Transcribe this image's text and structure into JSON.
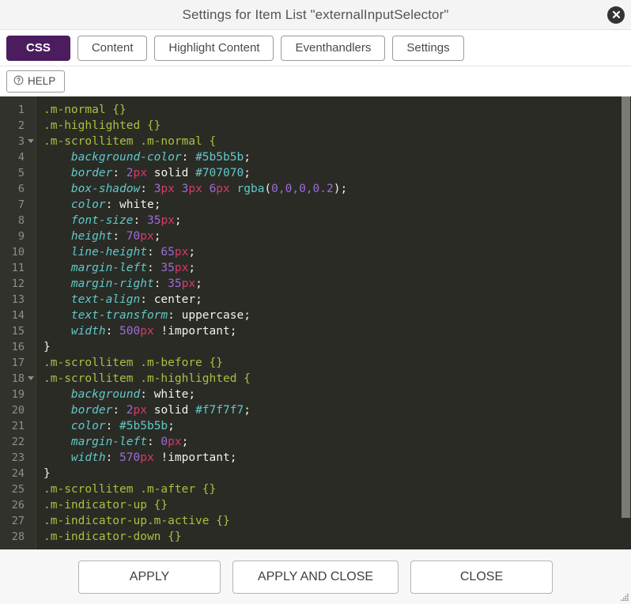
{
  "window": {
    "title": "Settings for Item List \"externalInputSelector\"",
    "close_icon": "close-circle-icon"
  },
  "tabs": [
    {
      "label": "CSS",
      "active": true
    },
    {
      "label": "Content",
      "active": false
    },
    {
      "label": "Highlight Content",
      "active": false
    },
    {
      "label": "Eventhandlers",
      "active": false
    },
    {
      "label": "Settings",
      "active": false
    }
  ],
  "toolbar": {
    "help_label": "HELP",
    "help_icon": "question-circle-icon"
  },
  "editor": {
    "language": "css",
    "first_visible_line": 1,
    "last_visible_line": 28,
    "lines": [
      {
        "n": 1,
        "fold": false,
        "tokens": [
          {
            "t": "sel",
            "v": ".m-normal {}"
          }
        ]
      },
      {
        "n": 2,
        "fold": false,
        "tokens": [
          {
            "t": "sel",
            "v": ".m-highlighted {}"
          }
        ]
      },
      {
        "n": 3,
        "fold": true,
        "tokens": [
          {
            "t": "sel",
            "v": ".m-scrollitem .m-normal {"
          }
        ]
      },
      {
        "n": 4,
        "fold": false,
        "tokens": [
          {
            "t": "prop",
            "v": "    background-color"
          },
          {
            "t": "punc",
            "v": ": "
          },
          {
            "t": "hex",
            "v": "#5b5b5b"
          },
          {
            "t": "punc",
            "v": ";"
          }
        ]
      },
      {
        "n": 5,
        "fold": false,
        "tokens": [
          {
            "t": "prop",
            "v": "    border"
          },
          {
            "t": "punc",
            "v": ": "
          },
          {
            "t": "num",
            "v": "2"
          },
          {
            "t": "unit",
            "v": "px"
          },
          {
            "t": "val",
            "v": " solid "
          },
          {
            "t": "hex",
            "v": "#707070"
          },
          {
            "t": "punc",
            "v": ";"
          }
        ]
      },
      {
        "n": 6,
        "fold": false,
        "tokens": [
          {
            "t": "prop",
            "v": "    box-shadow"
          },
          {
            "t": "punc",
            "v": ": "
          },
          {
            "t": "num",
            "v": "3"
          },
          {
            "t": "unit",
            "v": "px"
          },
          {
            "t": "val",
            "v": " "
          },
          {
            "t": "num",
            "v": "3"
          },
          {
            "t": "unit",
            "v": "px"
          },
          {
            "t": "val",
            "v": " "
          },
          {
            "t": "num",
            "v": "6"
          },
          {
            "t": "unit",
            "v": "px"
          },
          {
            "t": "val",
            "v": " "
          },
          {
            "t": "func",
            "v": "rgba"
          },
          {
            "t": "punc",
            "v": "("
          },
          {
            "t": "num",
            "v": "0,0,0,0.2"
          },
          {
            "t": "punc",
            "v": ");"
          }
        ]
      },
      {
        "n": 7,
        "fold": false,
        "tokens": [
          {
            "t": "prop",
            "v": "    color"
          },
          {
            "t": "punc",
            "v": ": "
          },
          {
            "t": "val",
            "v": "white"
          },
          {
            "t": "punc",
            "v": ";"
          }
        ]
      },
      {
        "n": 8,
        "fold": false,
        "tokens": [
          {
            "t": "prop",
            "v": "    font-size"
          },
          {
            "t": "punc",
            "v": ": "
          },
          {
            "t": "num",
            "v": "35"
          },
          {
            "t": "unit",
            "v": "px"
          },
          {
            "t": "punc",
            "v": ";"
          }
        ]
      },
      {
        "n": 9,
        "fold": false,
        "tokens": [
          {
            "t": "prop",
            "v": "    height"
          },
          {
            "t": "punc",
            "v": ": "
          },
          {
            "t": "num",
            "v": "70"
          },
          {
            "t": "unit",
            "v": "px"
          },
          {
            "t": "punc",
            "v": ";"
          }
        ]
      },
      {
        "n": 10,
        "fold": false,
        "tokens": [
          {
            "t": "prop",
            "v": "    line-height"
          },
          {
            "t": "punc",
            "v": ": "
          },
          {
            "t": "num",
            "v": "65"
          },
          {
            "t": "unit",
            "v": "px"
          },
          {
            "t": "punc",
            "v": ";"
          }
        ]
      },
      {
        "n": 11,
        "fold": false,
        "tokens": [
          {
            "t": "prop",
            "v": "    margin-left"
          },
          {
            "t": "punc",
            "v": ": "
          },
          {
            "t": "num",
            "v": "35"
          },
          {
            "t": "unit",
            "v": "px"
          },
          {
            "t": "punc",
            "v": ";"
          }
        ]
      },
      {
        "n": 12,
        "fold": false,
        "tokens": [
          {
            "t": "prop",
            "v": "    margin-right"
          },
          {
            "t": "punc",
            "v": ": "
          },
          {
            "t": "num",
            "v": "35"
          },
          {
            "t": "unit",
            "v": "px"
          },
          {
            "t": "punc",
            "v": ";"
          }
        ]
      },
      {
        "n": 13,
        "fold": false,
        "tokens": [
          {
            "t": "prop",
            "v": "    text-align"
          },
          {
            "t": "punc",
            "v": ": "
          },
          {
            "t": "val",
            "v": "center"
          },
          {
            "t": "punc",
            "v": ";"
          }
        ]
      },
      {
        "n": 14,
        "fold": false,
        "tokens": [
          {
            "t": "prop",
            "v": "    text-transform"
          },
          {
            "t": "punc",
            "v": ": "
          },
          {
            "t": "val",
            "v": "uppercase"
          },
          {
            "t": "punc",
            "v": ";"
          }
        ]
      },
      {
        "n": 15,
        "fold": false,
        "tokens": [
          {
            "t": "prop",
            "v": "    width"
          },
          {
            "t": "punc",
            "v": ": "
          },
          {
            "t": "num",
            "v": "500"
          },
          {
            "t": "unit",
            "v": "px"
          },
          {
            "t": "val",
            "v": " "
          },
          {
            "t": "imp",
            "v": "!important"
          },
          {
            "t": "punc",
            "v": ";"
          }
        ]
      },
      {
        "n": 16,
        "fold": false,
        "tokens": [
          {
            "t": "punc",
            "v": "}"
          }
        ]
      },
      {
        "n": 17,
        "fold": false,
        "tokens": [
          {
            "t": "sel",
            "v": ".m-scrollitem .m-before {}"
          }
        ]
      },
      {
        "n": 18,
        "fold": true,
        "tokens": [
          {
            "t": "sel",
            "v": ".m-scrollitem .m-highlighted {"
          }
        ]
      },
      {
        "n": 19,
        "fold": false,
        "tokens": [
          {
            "t": "prop",
            "v": "    background"
          },
          {
            "t": "punc",
            "v": ": "
          },
          {
            "t": "val",
            "v": "white"
          },
          {
            "t": "punc",
            "v": ";"
          }
        ]
      },
      {
        "n": 20,
        "fold": false,
        "tokens": [
          {
            "t": "prop",
            "v": "    border"
          },
          {
            "t": "punc",
            "v": ": "
          },
          {
            "t": "num",
            "v": "2"
          },
          {
            "t": "unit",
            "v": "px"
          },
          {
            "t": "val",
            "v": " solid "
          },
          {
            "t": "hex",
            "v": "#f7f7f7"
          },
          {
            "t": "punc",
            "v": ";"
          }
        ]
      },
      {
        "n": 21,
        "fold": false,
        "tokens": [
          {
            "t": "prop",
            "v": "    color"
          },
          {
            "t": "punc",
            "v": ": "
          },
          {
            "t": "hex",
            "v": "#5b5b5b"
          },
          {
            "t": "punc",
            "v": ";"
          }
        ]
      },
      {
        "n": 22,
        "fold": false,
        "tokens": [
          {
            "t": "prop",
            "v": "    margin-left"
          },
          {
            "t": "punc",
            "v": ": "
          },
          {
            "t": "num",
            "v": "0"
          },
          {
            "t": "unit",
            "v": "px"
          },
          {
            "t": "punc",
            "v": ";"
          }
        ]
      },
      {
        "n": 23,
        "fold": false,
        "tokens": [
          {
            "t": "prop",
            "v": "    width"
          },
          {
            "t": "punc",
            "v": ": "
          },
          {
            "t": "num",
            "v": "570"
          },
          {
            "t": "unit",
            "v": "px"
          },
          {
            "t": "val",
            "v": " "
          },
          {
            "t": "imp",
            "v": "!important"
          },
          {
            "t": "punc",
            "v": ";"
          }
        ]
      },
      {
        "n": 24,
        "fold": false,
        "tokens": [
          {
            "t": "punc",
            "v": "}"
          }
        ]
      },
      {
        "n": 25,
        "fold": false,
        "tokens": [
          {
            "t": "sel",
            "v": ".m-scrollitem .m-after {}"
          }
        ]
      },
      {
        "n": 26,
        "fold": false,
        "tokens": [
          {
            "t": "sel",
            "v": ".m-indicator-up {}"
          }
        ]
      },
      {
        "n": 27,
        "fold": false,
        "tokens": [
          {
            "t": "sel",
            "v": ".m-indicator-up.m-active {}"
          }
        ]
      },
      {
        "n": 28,
        "fold": false,
        "tokens": [
          {
            "t": "sel",
            "v": ".m-indicator-down {}"
          }
        ]
      }
    ],
    "scrollbar": {
      "thumb_percent": 93,
      "thumb_top_percent": 0
    }
  },
  "footer": {
    "buttons": [
      {
        "label": "APPLY"
      },
      {
        "label": "APPLY AND CLOSE"
      },
      {
        "label": "CLOSE"
      }
    ],
    "resize_handle": "resize-grip-icon"
  },
  "colors": {
    "accent_purple": "#4b1d5f",
    "editor_bg": "#2b2b26",
    "gutter_bg": "#32322c",
    "selector": "#a6c23c",
    "property": "#5fc9c9",
    "number": "#9b6cd6",
    "unit": "#d8386b",
    "scrollbar_thumb": "#7b7b76"
  }
}
